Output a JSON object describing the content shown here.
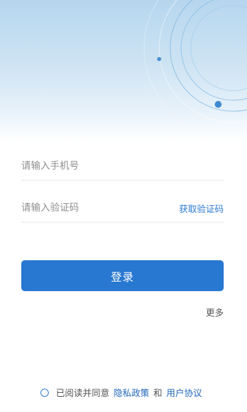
{
  "form": {
    "phone_placeholder": "请输入手机号",
    "code_placeholder": "请输入验证码",
    "get_code_label": "获取验证码"
  },
  "actions": {
    "login_label": "登录",
    "more_label": "更多"
  },
  "agreement": {
    "text_prefix": "已阅读并同意",
    "privacy_label": "隐私政策",
    "conjunction": "和",
    "terms_label": "用户协议",
    "checked": false
  },
  "theme": {
    "accent": "#2878d1",
    "link": "#2267b9",
    "hero_gradient_top": "#b6d6ee"
  }
}
